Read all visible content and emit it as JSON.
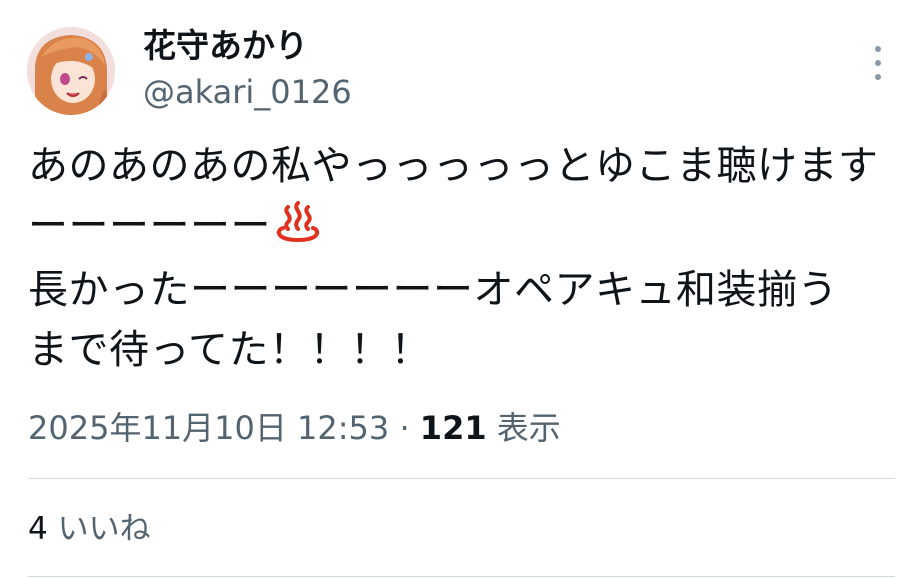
{
  "author": {
    "display_name": "花守あかり",
    "handle": "@akari_0126",
    "avatar_icon": "user-avatar"
  },
  "tweet": {
    "lines": [
      "あのあのあの私やっっっっっとゆこま聴けます",
      "ーーーーーー",
      "長かったーーーーーーーオペアキュ和装揃う",
      "まで待ってた！！！！"
    ],
    "emoji": "hot-springs-icon"
  },
  "meta": {
    "timestamp": "2025年11月10日 12:53",
    "separator": "·",
    "views_count": "121",
    "views_label": "表示"
  },
  "engagement": {
    "likes_count": "4",
    "likes_label": "いいね"
  },
  "colors": {
    "text": "#0f1419",
    "secondary": "#536471",
    "divider": "#cfd9de",
    "onsen": "#e0301e"
  }
}
